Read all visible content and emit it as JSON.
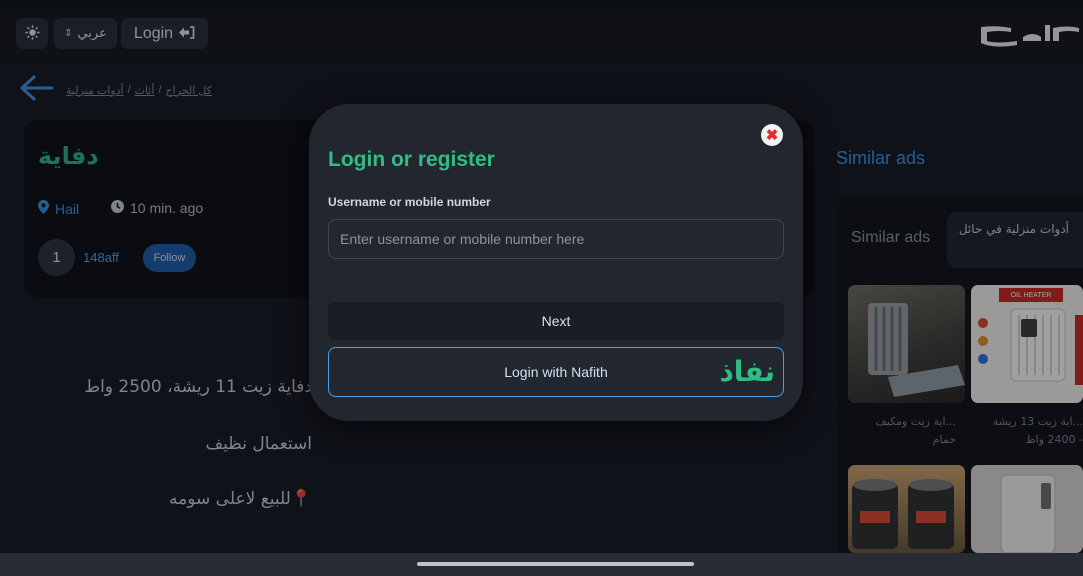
{
  "topbar": {
    "login_label": "Login",
    "language_label": "عربي",
    "logo_alt": "حراج"
  },
  "breadcrumb": [
    "كل الحراج",
    "أثاث",
    "أدوات منزلية"
  ],
  "ad": {
    "title": "دفاية",
    "location": "Hail",
    "time": "10 min. ago",
    "avatar_initial": "1",
    "username": "148aff",
    "follow_label": "Follow",
    "description": [
      "دفاية زيت 11 ريشة، 2500 واط",
      "استعمال نظيف",
      "📍للبيع لاعلى سومه"
    ]
  },
  "similar": {
    "title": "Similar ads",
    "label": "Similar ads",
    "category": "أدوات منزلية في حائل",
    "items": [
      {
        "caption_1": "...اية زيت ومكيف",
        "caption_2": "حمام"
      },
      {
        "caption_1": "...اية زيت 13 ريشة",
        "caption_2": "- 2400 واط"
      }
    ],
    "thumb_text": "OIL HEATER"
  },
  "modal": {
    "title": "Login or register",
    "field_label": "Username or mobile number",
    "field_placeholder": "Enter username or mobile number here",
    "field_value": "",
    "next_label": "Next",
    "nafith_label": "Login with Nafith",
    "nafith_logo": "نفاذ"
  },
  "colors": {
    "accent_green": "#2fbd84",
    "accent_blue": "#3d8fdf",
    "close_red": "#e02e2e"
  }
}
